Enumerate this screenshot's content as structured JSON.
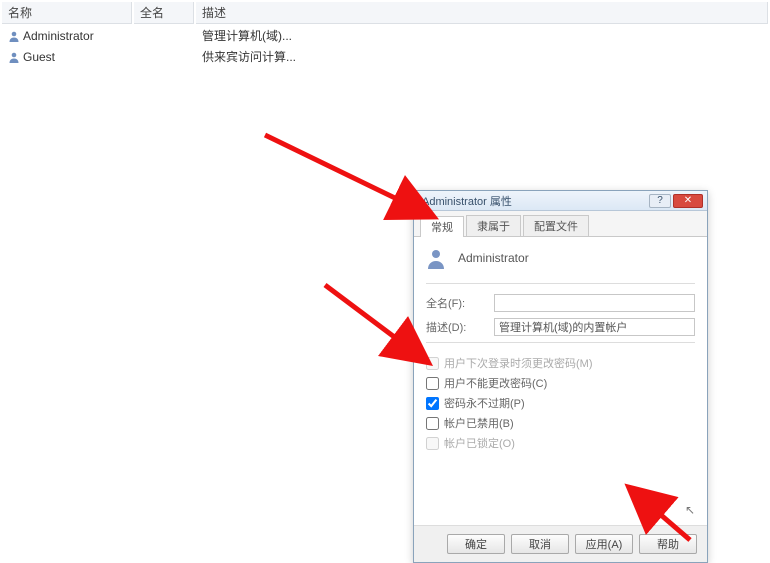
{
  "table": {
    "headers": {
      "name": "名称",
      "fullname": "全名",
      "desc": "描述"
    },
    "rows": [
      {
        "name": "Administrator",
        "desc": "管理计算机(域)..."
      },
      {
        "name": "Guest",
        "desc": "供来宾访问计算..."
      }
    ]
  },
  "dialog": {
    "title": "Administrator 属性",
    "tabs": {
      "general": "常规",
      "member_of": "隶属于",
      "profile": "配置文件"
    },
    "username": "Administrator",
    "fields": {
      "fullname_label": "全名(F):",
      "fullname_value": "",
      "desc_label": "描述(D):",
      "desc_value": "管理计算机(域)的内置帐户"
    },
    "checks": {
      "must_change": "用户下次登录时须更改密码(M)",
      "cannot_change": "用户不能更改密码(C)",
      "never_expire": "密码永不过期(P)",
      "disabled": "帐户已禁用(B)",
      "locked": "帐户已锁定(O)"
    },
    "buttons": {
      "ok": "确定",
      "cancel": "取消",
      "apply": "应用(A)",
      "help": "帮助"
    }
  }
}
